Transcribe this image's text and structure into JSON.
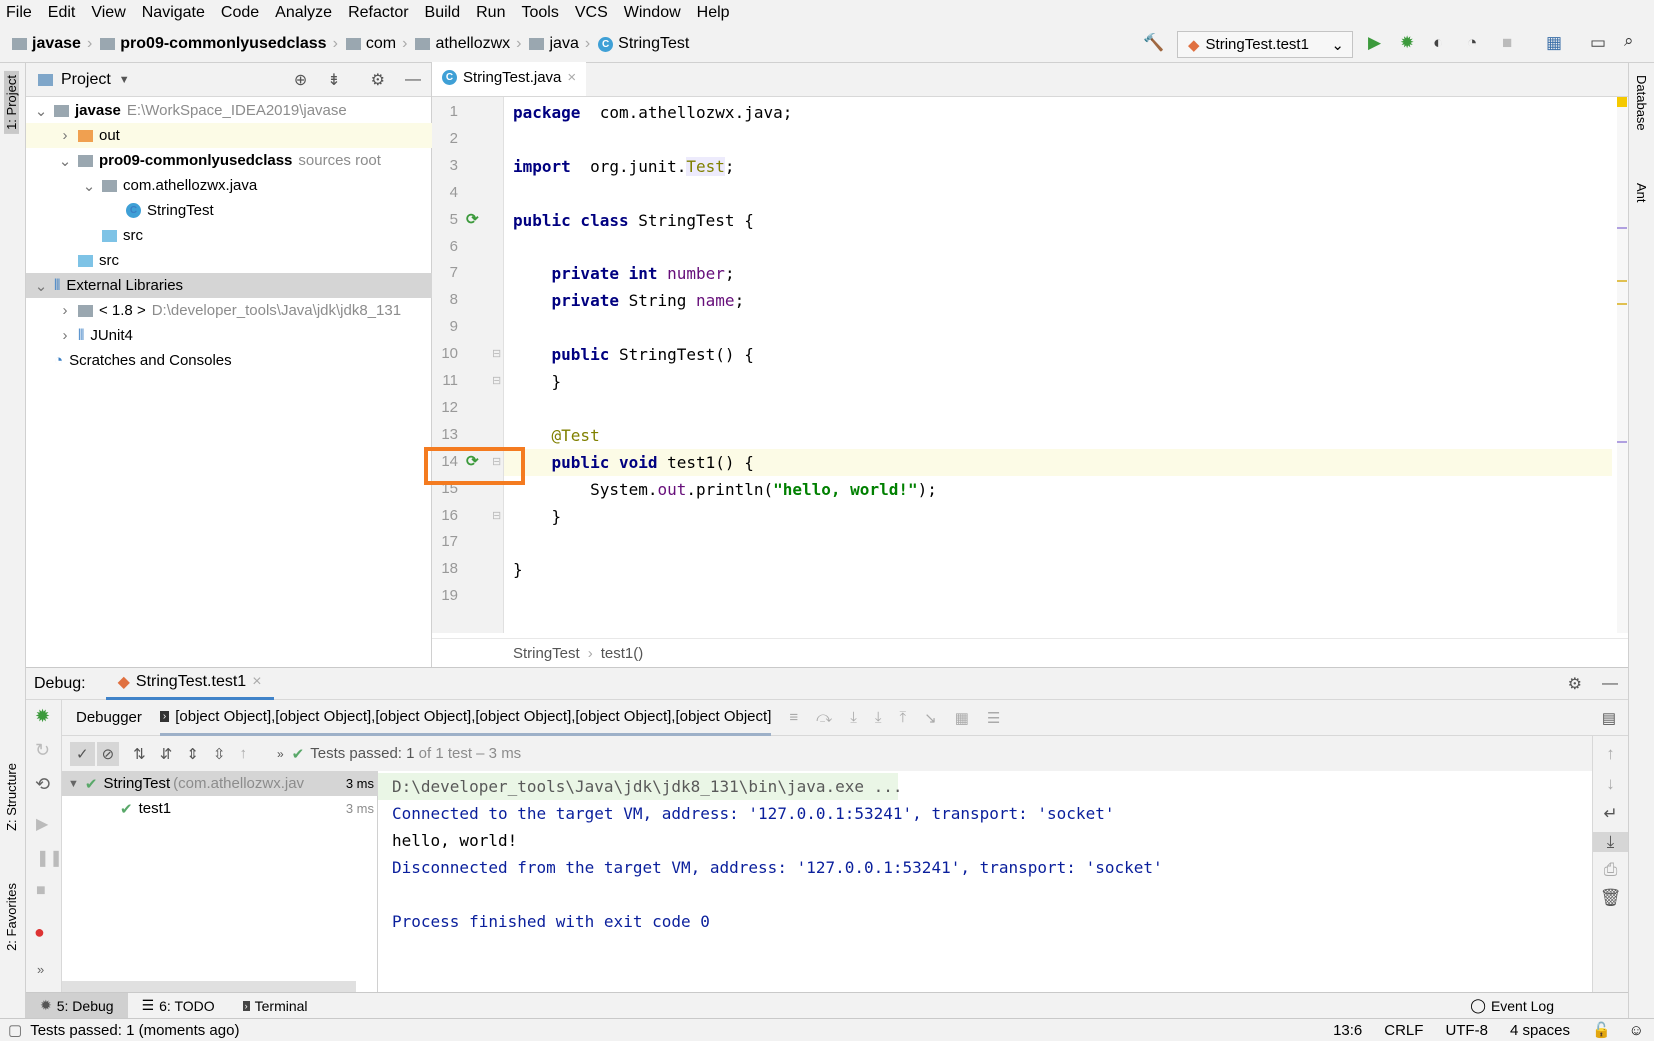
{
  "menu": [
    "File",
    "Edit",
    "View",
    "Navigate",
    "Code",
    "Analyze",
    "Refactor",
    "Build",
    "Run",
    "Tools",
    "VCS",
    "Window",
    "Help"
  ],
  "breadcrumb": [
    "javase",
    "pro09-commonlyusedclass",
    "com",
    "athellozwx",
    "java",
    "StringTest"
  ],
  "run_config": "StringTest.test1",
  "left_strip": {
    "project": "1: Project",
    "structure": "Z: Structure",
    "favorites": "2: Favorites"
  },
  "right_strip": {
    "database": "Database",
    "ant": "Ant"
  },
  "project": {
    "title": "Project",
    "rows": [
      {
        "label": "javase",
        "hint": "E:\\WorkSpace_IDEA2019\\javase",
        "indent": 0,
        "arrow": "v",
        "bold": true
      },
      {
        "label": "out",
        "hint": "",
        "indent": 1,
        "arrow": ">",
        "bold": false
      },
      {
        "label": "pro09-commonlyusedclass",
        "hint": "sources root",
        "indent": 1,
        "arrow": "v",
        "bold": true
      },
      {
        "label": "com.athellozwx.java",
        "hint": "",
        "indent": 2,
        "arrow": "v",
        "bold": false
      },
      {
        "label": "StringTest",
        "hint": "",
        "indent": 3,
        "arrow": "",
        "bold": false
      },
      {
        "label": "src",
        "hint": "",
        "indent": 2,
        "arrow": "",
        "bold": false
      },
      {
        "label": "src",
        "hint": "",
        "indent": 1,
        "arrow": "",
        "bold": false
      },
      {
        "label": "External Libraries",
        "hint": "",
        "indent": 0,
        "arrow": "v",
        "bold": false
      },
      {
        "label": "< 1.8 >",
        "hint": "D:\\developer_tools\\Java\\jdk\\jdk8_131",
        "indent": 1,
        "arrow": ">",
        "bold": false
      },
      {
        "label": "JUnit4",
        "hint": "",
        "indent": 1,
        "arrow": ">",
        "bold": false
      },
      {
        "label": "Scratches and Consoles",
        "hint": "",
        "indent": 0,
        "arrow": "",
        "bold": false
      }
    ]
  },
  "editor": {
    "tab": "StringTest.java",
    "crumb": [
      "StringTest",
      "test1()"
    ],
    "lines": [
      [
        [
          "kw",
          "package"
        ],
        [
          "",
          "  com.athellozwx.java;"
        ]
      ],
      [],
      [
        [
          "kw",
          "import"
        ],
        [
          "",
          "  org.junit."
        ],
        [
          "ann",
          "Test"
        ],
        [
          "",
          ";"
        ]
      ],
      [],
      [
        [
          "kw",
          "public class"
        ],
        [
          "",
          " StringTest {"
        ]
      ],
      [],
      [
        [
          "",
          "    "
        ],
        [
          "kw",
          "private int"
        ],
        [
          "",
          " "
        ],
        [
          "fld",
          "number"
        ],
        [
          "",
          ";"
        ]
      ],
      [
        [
          "",
          "    "
        ],
        [
          "kw",
          "private"
        ],
        [
          "",
          " String "
        ],
        [
          "fld",
          "name"
        ],
        [
          "",
          ";"
        ]
      ],
      [],
      [
        [
          "",
          "    "
        ],
        [
          "kw",
          "public"
        ],
        [
          "",
          " StringTest() {"
        ]
      ],
      [
        [
          "",
          "    }"
        ]
      ],
      [],
      [
        [
          "",
          "    "
        ],
        [
          "ann",
          "@Test"
        ]
      ],
      [
        [
          "",
          "    "
        ],
        [
          "kw",
          "public void"
        ],
        [
          "",
          " test1() {"
        ]
      ],
      [
        [
          "",
          "        System."
        ],
        [
          "fld",
          "out"
        ],
        [
          "",
          ".println("
        ],
        [
          "str",
          "\"hello, world!\""
        ],
        [
          "",
          ");"
        ]
      ],
      [
        [
          "",
          "    }"
        ]
      ],
      [],
      [
        [
          "",
          "}"
        ]
      ],
      []
    ]
  },
  "debug": {
    "label": "Debug:",
    "tab": "StringTest.test1",
    "debugger": "Debugger",
    "console": [
      {
        "text": "D:\\developer_tools\\Java\\jdk\\jdk8_131\\bin\\java.exe ...",
        "color": "#595959"
      },
      {
        "text": "Connected to the target VM, address: '127.0.0.1:53241', transport: 'socket'",
        "color": "#0a1f9c"
      },
      {
        "text": "hello, world!",
        "color": "#000000"
      },
      {
        "text": "Disconnected from the target VM, address: '127.0.0.1:53241', transport: 'socket'",
        "color": "#0a1f9c"
      },
      {
        "text": "",
        "color": "#000"
      },
      {
        "text": "Process finished with exit code 0",
        "color": "#0a1f9c"
      }
    ],
    "tests_passed": "Tests passed:",
    "tests_count": "1",
    "tests_rest": "of 1 test – 3 ms",
    "tree": [
      {
        "name": "StringTest",
        "pkg": "(com.athellozwx.jav",
        "time": "3 ms"
      },
      {
        "name": "test1",
        "pkg": "",
        "time": "3 ms"
      }
    ]
  },
  "bottom_tabs": [
    "5: Debug",
    "6: TODO",
    "Terminal"
  ],
  "event_log": "Event Log",
  "status": {
    "message": "Tests passed: 1 (moments ago)",
    "position": "13:6",
    "line_sep": "CRLF",
    "encoding": "UTF-8",
    "indent": "4 spaces"
  },
  "colors": {
    "accent": "#4083c9",
    "highlight": "#f47b20",
    "pass": "#59a869"
  }
}
